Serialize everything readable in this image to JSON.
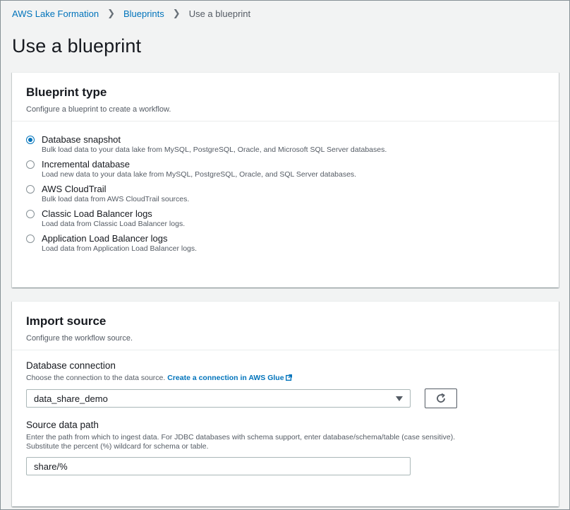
{
  "breadcrumb": {
    "items": [
      "AWS Lake Formation",
      "Blueprints"
    ],
    "current": "Use a blueprint"
  },
  "page_title": "Use a blueprint",
  "blueprint_type": {
    "title": "Blueprint type",
    "description": "Configure a blueprint to create a workflow.",
    "options": [
      {
        "label": "Database snapshot",
        "desc": "Bulk load data to your data lake from MySQL, PostgreSQL, Oracle, and Microsoft SQL Server databases.",
        "selected": true
      },
      {
        "label": "Incremental database",
        "desc": "Load new data to your data lake from MySQL, PostgreSQL, Oracle, and SQL Server databases.",
        "selected": false
      },
      {
        "label": "AWS CloudTrail",
        "desc": "Bulk load data from AWS CloudTrail sources.",
        "selected": false
      },
      {
        "label": "Classic Load Balancer logs",
        "desc": "Load data from Classic Load Balancer logs.",
        "selected": false
      },
      {
        "label": "Application Load Balancer logs",
        "desc": "Load data from Application Load Balancer logs.",
        "selected": false
      }
    ]
  },
  "import_source": {
    "title": "Import source",
    "description": "Configure the workflow source.",
    "db_connection": {
      "label": "Database connection",
      "desc": "Choose the connection to the data source.",
      "link": "Create a connection in AWS Glue",
      "value": "data_share_demo"
    },
    "source_path": {
      "label": "Source data path",
      "desc_line1": "Enter the path from which to ingest data. For JDBC databases with schema support, enter database/schema/table (case sensitive).",
      "desc_line2": "Substitute the percent (%) wildcard for schema or table.",
      "value": "share/%"
    }
  },
  "colors": {
    "link": "#0073bb",
    "accent": "#0073bb"
  },
  "icons": {
    "external": "external-link-icon",
    "refresh": "refresh-icon",
    "dropdown": "caret-down-icon"
  }
}
